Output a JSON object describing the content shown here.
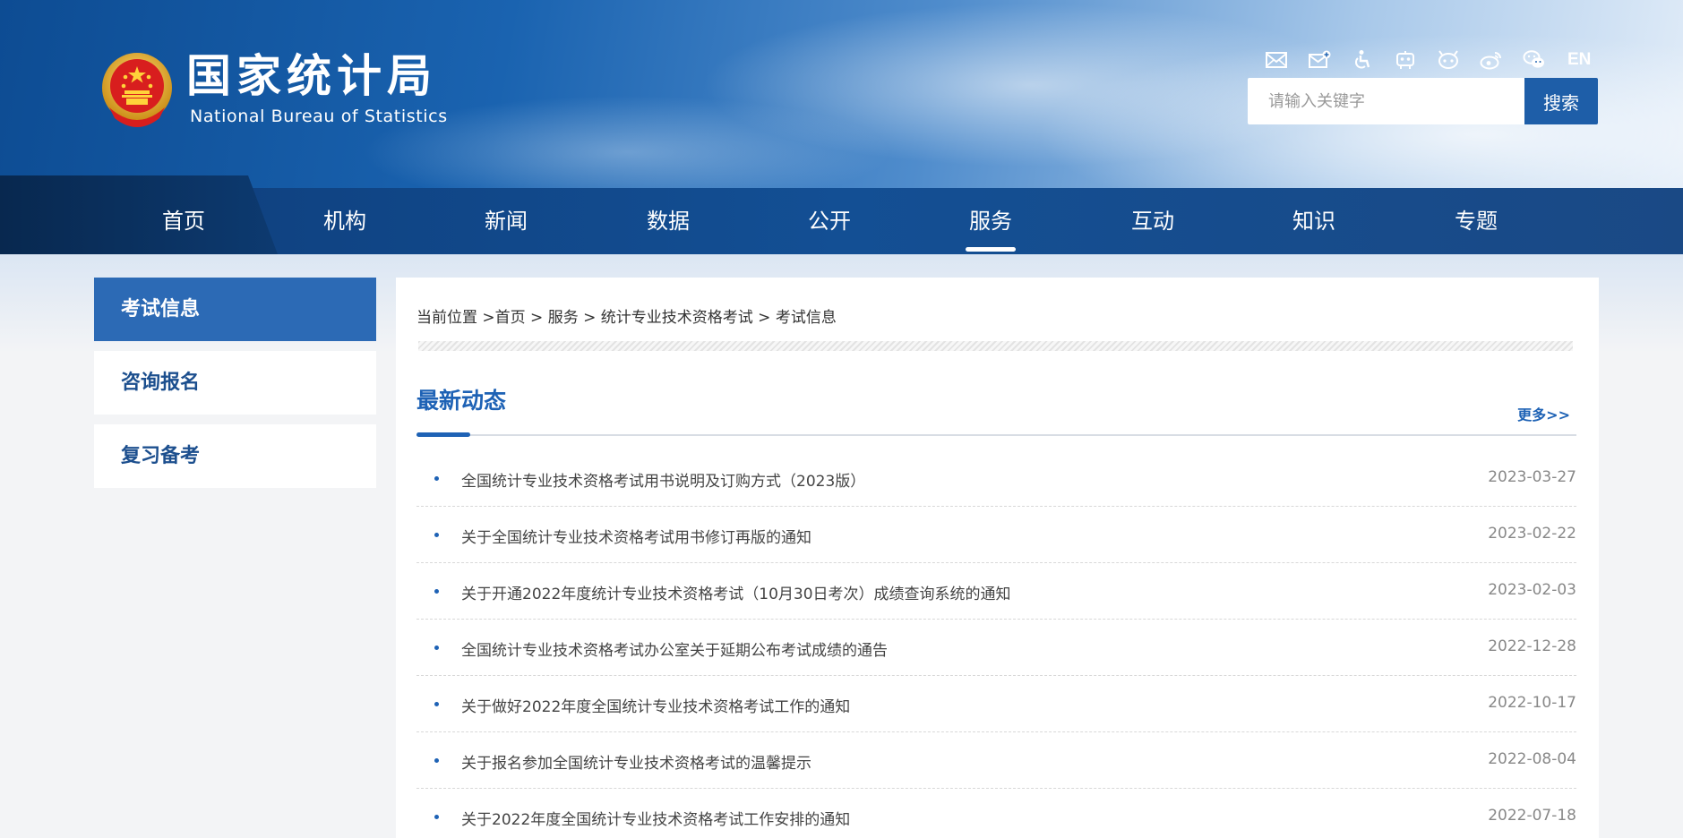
{
  "header": {
    "logo_cn": "国家统计局",
    "logo_en": "National Bureau of Statistics",
    "tools": [
      {
        "icon": "mail-icon"
      },
      {
        "icon": "mail-plus-icon"
      },
      {
        "icon": "accessibility-icon"
      },
      {
        "icon": "robot-icon"
      },
      {
        "icon": "app-icon"
      },
      {
        "icon": "weibo-icon"
      },
      {
        "icon": "wechat-icon"
      }
    ],
    "lang_label": "EN",
    "search": {
      "placeholder": "请输入关键字",
      "button_label": "搜索"
    }
  },
  "nav": {
    "active": "服务",
    "items": [
      {
        "label": "首页"
      },
      {
        "label": "机构"
      },
      {
        "label": "新闻"
      },
      {
        "label": "数据"
      },
      {
        "label": "公开"
      },
      {
        "label": "服务"
      },
      {
        "label": "互动"
      },
      {
        "label": "知识"
      },
      {
        "label": "专题"
      }
    ]
  },
  "sidebar": {
    "items": [
      {
        "label": "考试信息",
        "active": true
      },
      {
        "label": "咨询报名",
        "active": false
      },
      {
        "label": "复习备考",
        "active": false
      }
    ]
  },
  "breadcrumb": {
    "prefix": "当前位置 >",
    "items": [
      "首页",
      "服务",
      "统计专业技术资格考试",
      "考试信息"
    ],
    "separator": " > "
  },
  "section": {
    "title": "最新动态",
    "more_label": "更多>>"
  },
  "news": [
    {
      "title": "全国统计专业技术资格考试用书说明及订购方式（2023版）",
      "date": "2023-03-27"
    },
    {
      "title": "关于全国统计专业技术资格考试用书修订再版的通知",
      "date": "2023-02-22"
    },
    {
      "title": "关于开通2022年度统计专业技术资格考试（10月30日考次）成绩查询系统的通知",
      "date": "2023-02-03"
    },
    {
      "title": "全国统计专业技术资格考试办公室关于延期公布考试成绩的通告",
      "date": "2022-12-28"
    },
    {
      "title": "关于做好2022年度全国统计专业技术资格考试工作的通知",
      "date": "2022-10-17"
    },
    {
      "title": "关于报名参加全国统计专业技术资格考试的温馨提示",
      "date": "2022-08-04"
    },
    {
      "title": "关于2022年度全国统计专业技术资格考试工作安排的通知",
      "date": "2022-07-18"
    }
  ],
  "colors": {
    "accent": "#1e62b5",
    "nav_bg": "#134f94",
    "sidebar_active": "#2c6ab5"
  }
}
